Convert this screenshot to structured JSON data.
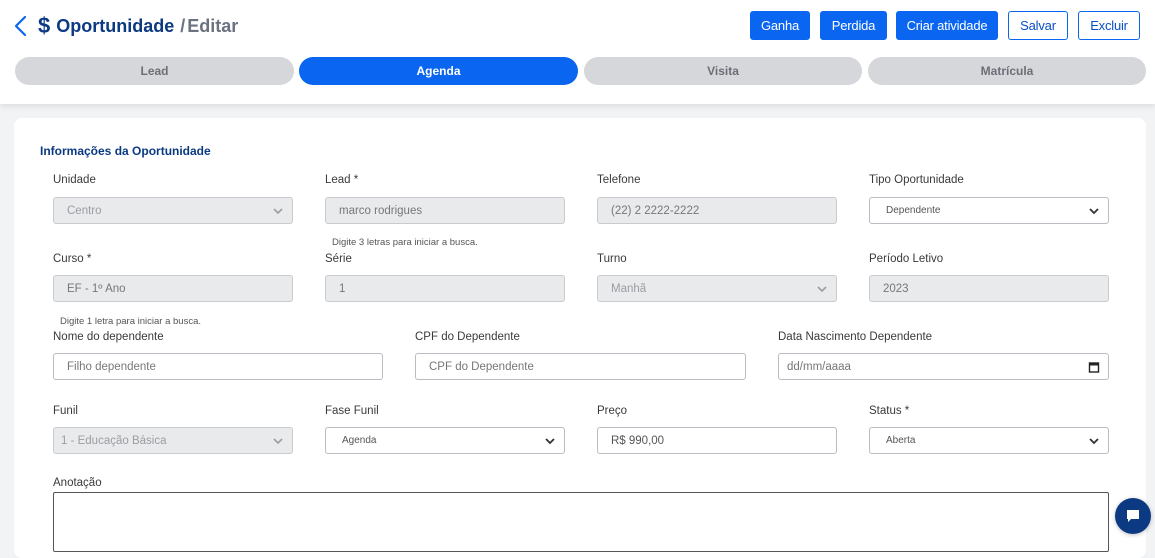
{
  "header": {
    "title": "Oportunidade",
    "separator": "/",
    "subtitle": "Editar"
  },
  "actions": {
    "ganha": "Ganha",
    "perdida": "Perdida",
    "criar_atividade": "Criar atividade",
    "salvar": "Salvar",
    "excluir": "Excluir"
  },
  "steps": [
    {
      "label": "Lead",
      "active": false
    },
    {
      "label": "Agenda",
      "active": true
    },
    {
      "label": "Visita",
      "active": false
    },
    {
      "label": "Matrícula",
      "active": false
    }
  ],
  "form": {
    "section_title": "Informações da Oportunidade",
    "unidade": {
      "label": "Unidade",
      "value": "Centro"
    },
    "lead": {
      "label": "Lead *",
      "value": "marco  rodrigues",
      "hint": "Digite 3 letras para iniciar a busca."
    },
    "telefone": {
      "label": "Telefone",
      "value": "(22) 2 2222-2222"
    },
    "tipo_oportunidade": {
      "label": "Tipo Oportunidade",
      "value": "Dependente"
    },
    "curso": {
      "label": "Curso *",
      "value": "EF - 1º Ano",
      "hint": "Digite 1 letra para iniciar a busca."
    },
    "serie": {
      "label": "Série",
      "value": "1"
    },
    "turno": {
      "label": "Turno",
      "value": "Manhã"
    },
    "periodo_letivo": {
      "label": "Período Letivo",
      "value": "2023"
    },
    "nome_dependente": {
      "label": "Nome do dependente",
      "placeholder": "Filho dependente"
    },
    "cpf_dependente": {
      "label": "CPF do Dependente",
      "placeholder": "CPF do Dependente"
    },
    "data_nascimento": {
      "label": "Data Nascimento Dependente",
      "placeholder": "dd/mm/aaaa"
    },
    "funil": {
      "label": "Funil",
      "value": "1 - Educação Básica"
    },
    "fase_funil": {
      "label": "Fase Funil",
      "value": "Agenda"
    },
    "preco": {
      "label": "Preço",
      "value": "R$ 990,00"
    },
    "status": {
      "label": "Status *",
      "value": "Aberta"
    },
    "anotacao": {
      "label": "Anotação",
      "value": ""
    }
  },
  "colors": {
    "primary": "#0a66f0",
    "brand_dark": "#0b3a82",
    "step_inactive": "#d6d7db"
  },
  "icons": {
    "back": "chevron-left-icon",
    "dollar": "dollar-icon",
    "select": "chevron-down-icon",
    "calendar": "calendar-icon",
    "chat": "chat-icon"
  }
}
